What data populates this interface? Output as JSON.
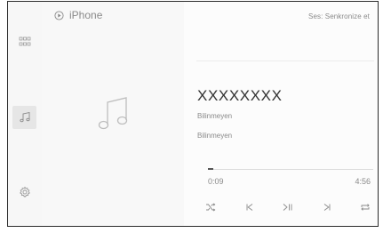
{
  "header": {
    "source_label": "iPhone",
    "status": "Ses: Senkronize et"
  },
  "sidebar": {
    "items": [
      {
        "icon": "apps-grid-icon",
        "active": false
      },
      {
        "icon": "music-note-icon",
        "active": true
      },
      {
        "icon": "gear-icon",
        "active": false
      }
    ]
  },
  "track": {
    "title": "XXXXXXXX",
    "artist": "Bilinmeyen",
    "album": "Bilinmeyen"
  },
  "playback": {
    "elapsed": "0:09",
    "total": "4:56",
    "progress_fraction": 0.03
  },
  "controls": [
    {
      "icon": "shuffle-icon"
    },
    {
      "icon": "previous-track-icon"
    },
    {
      "icon": "play-pause-icon"
    },
    {
      "icon": "next-track-icon"
    },
    {
      "icon": "repeat-icon"
    }
  ]
}
